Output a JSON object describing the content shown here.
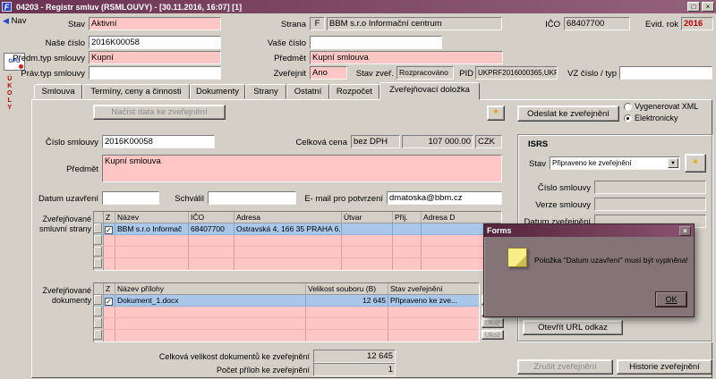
{
  "icons": {
    "nav_arrow": "◀",
    "spark": "*",
    "dropdown_arrow": "▼"
  },
  "window": {
    "logo": "F",
    "title": "04203 - Registr smluv (RSMLOUVY) - [30.11.2016, 16:07] [1]",
    "restore_glyph": "□",
    "close_glyph": "×"
  },
  "sidebar": {
    "nav_label": "Nav",
    "gpg_label": "GPG",
    "ukoly_label": "Ú\nK\nO\nL\nY"
  },
  "header": {
    "stav": {
      "label": "Stav",
      "value": "Aktivní"
    },
    "strana": {
      "label": "Strana",
      "code": "F",
      "name": "BBM s.r.o Informační centrum"
    },
    "ico": {
      "label": "IČO",
      "value": "68407700"
    },
    "evid_rok": {
      "label": "Evid. rok",
      "value": "2016"
    },
    "nase_cislo": {
      "label": "Naše číslo",
      "value": "2016K00058"
    },
    "vase_cislo": {
      "label": "Vaše číslo",
      "value": ""
    },
    "predm_typ": {
      "label": "Předm.typ smlouvy",
      "value": "Kupní"
    },
    "predmet": {
      "label": "Předmět",
      "value": "Kupní smlouva"
    },
    "prav_typ": {
      "label": "Práv.typ smlouvy",
      "value": ""
    },
    "zverejnit": {
      "label": "Zveřejnit",
      "value": "Ano"
    },
    "stav_zver": {
      "label": "Stav zveř.",
      "value": "Rozpracováno"
    },
    "pid": {
      "label": "PID",
      "value": "UKPRF2016000365,UKPI"
    },
    "vz_cislo": {
      "label": "VZ číslo / typ",
      "value": ""
    }
  },
  "tabs": {
    "items": [
      "Smlouva",
      "Termíny, ceny a činnosti",
      "Dokumenty",
      "Strany",
      "Ostatní",
      "Rozpočet",
      "Zveřejňovací doložka"
    ],
    "active": "Zveřejňovací doložka"
  },
  "content": {
    "load_button": "Načíst data ke zveřejnění",
    "cislo_smlouvy": {
      "label": "Číslo smlouvy",
      "value": "2016K00058"
    },
    "celkova_cena": {
      "label": "Celková cena",
      "dph": "bez DPH",
      "amount": "107 000.00",
      "currency": "CZK"
    },
    "predmet": {
      "label": "Předmět",
      "value": "Kupní smlouva"
    },
    "datum_uzavreni": {
      "label": "Datum uzavření",
      "value": ""
    },
    "schvalil": {
      "label": "Schválil",
      "value": ""
    },
    "email": {
      "label": "E- mail pro potvrzení",
      "value": "dmatoska@bbm.cz"
    },
    "strany_caption_1": "Zveřejňované",
    "strany_caption_2": "smluvní strany",
    "strany_table": {
      "columns": [
        "Z",
        "Název",
        "IČO",
        "Adresa",
        "Útvar",
        "Přij.",
        "Adresa D"
      ],
      "rows": [
        {
          "z": "✓",
          "nazev": "BBM s.r.o Informač",
          "ico": "68407700",
          "adresa": "Ostravská 4, 166 35 PRAHA 6.",
          "utvar": "",
          "prij": "",
          "adresa_d": ""
        }
      ]
    },
    "dokumenty_caption_1": "Zveřejňované",
    "dokumenty_caption_2": "dokumenty",
    "dokumenty_table": {
      "columns": [
        "Z",
        "Název přílohy",
        "Velikost souboru (B)",
        "Stav zveřejnění"
      ],
      "rows": [
        {
          "z": "✓",
          "nazev": "Dokument_1.docx",
          "velikost": "12 645",
          "stav": "Připraveno ke zve..."
        }
      ],
      "ukaz_label": "Ukaž"
    },
    "celkova_velikost": {
      "label": "Celková velikost dokumentů ke zveřejnění",
      "value": "12 645"
    },
    "pocet_priloh": {
      "label": "Počet příloh ke zveřejnění",
      "value": "1"
    }
  },
  "right_panel": {
    "odeslat_button": "Odeslat ke zveřejnění",
    "radio_xml": "Vygenerovat XML",
    "radio_elektronicky": "Elektronicky",
    "isrs": {
      "title": "ISRS",
      "stav": {
        "label": "Stav",
        "value": "Připraveno ke zveřejnění"
      },
      "cislo_smlouvy": {
        "label": "Číslo smlouvy",
        "value": ""
      },
      "verze_smlouvy": {
        "label": "Verze smlouvy",
        "value": ""
      },
      "datum_zverejneni": {
        "label": "Datum zveřejnění",
        "value": ""
      },
      "url_button": "Otevřít URL odkaz"
    },
    "zrusit_button": "Zrušit zveřejnění",
    "historie_button": "Historie zveřejnění"
  },
  "dialog": {
    "title": "Forms",
    "close_glyph": "×",
    "message": "Položka \"Datum uzavření\" musí být vyplněna!",
    "ok_button": "OK"
  }
}
